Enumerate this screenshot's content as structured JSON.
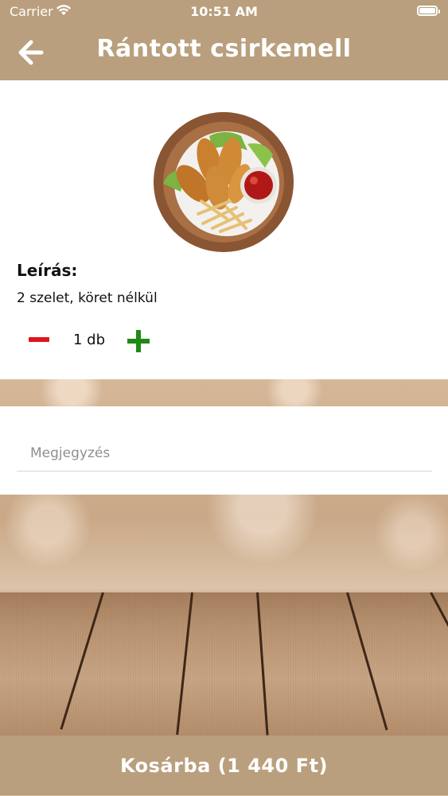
{
  "status_bar": {
    "carrier": "Carrier",
    "time": "10:51 AM"
  },
  "header": {
    "title": "Rántott csirkemell",
    "back_icon": "arrow-left-icon"
  },
  "product": {
    "image_alt": "rántott csirke tányéron",
    "description_label": "Leírás:",
    "description": "2 szelet, köret nélkül",
    "quantity_label": "1 db",
    "minus_icon": "minus-icon",
    "plus_icon": "plus-icon"
  },
  "note": {
    "placeholder": "Megjegyzés",
    "value": ""
  },
  "cart_button": {
    "label": "Kosárba (1 440 Ft)"
  },
  "colors": {
    "accent": "#b99f7d",
    "minus": "#e0141c",
    "plus": "#1e8a14"
  }
}
